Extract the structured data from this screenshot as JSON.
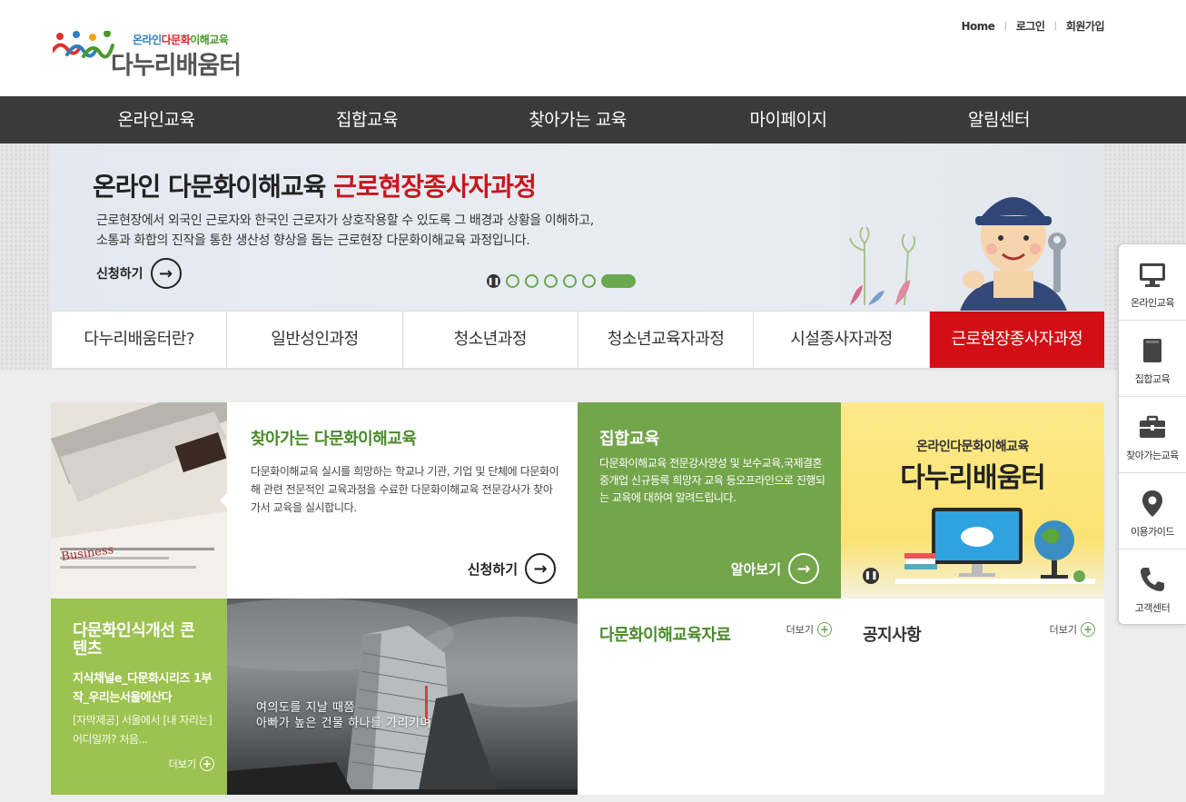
{
  "header": {
    "logo_small_1": "온라인",
    "logo_small_2": "다문화",
    "logo_small_3": "이해교육",
    "logo_big": "다누리배움터",
    "links": [
      "Home",
      "로그인",
      "회원가입"
    ]
  },
  "nav": {
    "items": [
      "온라인교육",
      "집합교육",
      "찾아가는 교육",
      "마이페이지",
      "알림센터"
    ]
  },
  "hero": {
    "title_prefix": "온라인 다문화이해교육 ",
    "title_highlight": "근로현장종사자과정",
    "desc_line1": "근로현장에서 외국인 근로자와 한국인 근로자가 상호작용할 수 있도록 그 배경과 상황을 이해하고,",
    "desc_line2": "소통과 화합의 진작을 통한 생산성 향상을 돕는 근로현장 다문화이해교육 과정입니다.",
    "apply_label": "신청하기"
  },
  "course_tabs": [
    "다누리배움터란?",
    "일반성인과정",
    "청소년과정",
    "청소년교육자과정",
    "시설종사자과정",
    "근로현장종사자과정"
  ],
  "quick_menu": [
    "온라인교육",
    "집합교육",
    "찾아가는교육",
    "이용가이드",
    "고객센터"
  ],
  "visit": {
    "title": "찾아가는 다문화이해교육",
    "desc": "다문화이해교육 실시를 희망하는 학교나 기관, 기업 및 단체에 다문화이해 관련 전문적인 교육과정을 수료한 다문화이해교육 전문강사가 찾아가서 교육을 실시합니다.",
    "apply_label": "신청하기"
  },
  "group": {
    "title": "집합교육",
    "desc": "다문화이해교육 전문강사양성 및 보수교육,국제결혼중개업 신규등록 희망자 교육 등오프라인으로 진행되는 교육에 대하여 알려드립니다.",
    "more_label": "알아보기"
  },
  "promo": {
    "small": "온라인다문화이해교육",
    "big": "다누리배움터"
  },
  "campaign": {
    "title": "다문화인식개선 콘텐츠",
    "subtitle": "지식채널e_다문화시리즈 1부작_우리는서울에산다",
    "desc": "[자막제공] 서울에서 [내 자리는] 어디일까? 처음...",
    "more_label": "더보기"
  },
  "video": {
    "caption_line1": "여의도를 지날 때쯤",
    "caption_line2": "아빠가 높은 건물 하나를 가리키며"
  },
  "boards": {
    "materials_title": "다문화이해교육자료",
    "notice_title": "공지사항",
    "more_label": "더보기"
  },
  "colors": {
    "nav_bg": "#3a3a3a",
    "accent_red": "#d20f14",
    "green": "#73a54a",
    "light_green": "#9cc24f",
    "yellow": "#fbe372"
  }
}
